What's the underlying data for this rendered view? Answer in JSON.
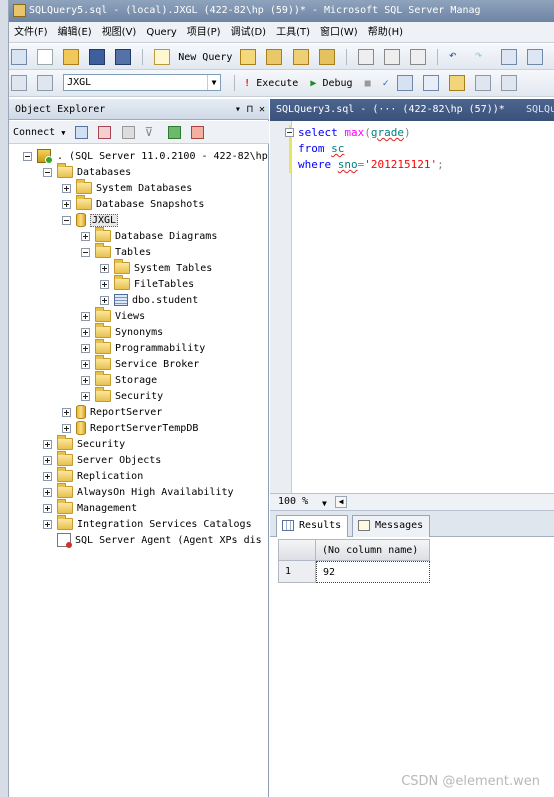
{
  "window": {
    "title": "SQLQuery5.sql - (local).JXGL (422-82\\hp (59))* - Microsoft SQL Server Manag"
  },
  "menu": {
    "items": [
      "文件(F)",
      "编辑(E)",
      "视图(V)",
      "Query",
      "项目(P)",
      "调试(D)",
      "工具(T)",
      "窗口(W)",
      "帮助(H)"
    ]
  },
  "toolbar": {
    "new_query_label": "New Query",
    "database": "JXGL",
    "execute_label": "Execute",
    "debug_label": "Debug"
  },
  "object_explorer": {
    "title": "Object Explorer",
    "header_buttons": "▾ ⊓ ✕",
    "connect_label": "Connect",
    "tree": {
      "server": "(SQL Server 11.0.2100 - 422-82\\hp",
      "databases": "Databases",
      "system_databases": "System Databases",
      "database_snapshots": "Database Snapshots",
      "jxgl": "JXGL",
      "database_diagrams": "Database Diagrams",
      "tables": "Tables",
      "system_tables": "System Tables",
      "file_tables": "FileTables",
      "dbo_student": "dbo.student",
      "views": "Views",
      "synonyms": "Synonyms",
      "programmability": "Programmability",
      "service_broker": "Service Broker",
      "storage": "Storage",
      "db_security": "Security",
      "report_server": "ReportServer",
      "report_server_temp": "ReportServerTempDB",
      "security": "Security",
      "server_objects": "Server Objects",
      "replication": "Replication",
      "alwayson": "AlwaysOn High Availability",
      "management": "Management",
      "integration_services": "Integration Services Catalogs",
      "sql_agent": "SQL Server Agent (Agent XPs dis"
    }
  },
  "editor": {
    "tab_title": "SQLQuery3.sql - (··· (422-82\\hp (57))*",
    "tab2_title": "SQLQu",
    "code": {
      "l1_kw": "select",
      "l1_fn": "max",
      "l1_open": "(",
      "l1_col": "grade",
      "l1_close": ")",
      "l2_kw": "from",
      "l2_tbl": "sc",
      "l3_kw": "where",
      "l3_col": "sno",
      "l3_op": "=",
      "l3_val": "'201215121'",
      "l3_end": ";"
    }
  },
  "zoom": {
    "value": "100 %"
  },
  "results": {
    "tabs": [
      "Results",
      "Messages"
    ],
    "columns": [
      "(No column name)"
    ],
    "rows": [
      {
        "num": "1",
        "value": "92"
      }
    ]
  },
  "watermark": "CSDN @element.wen"
}
